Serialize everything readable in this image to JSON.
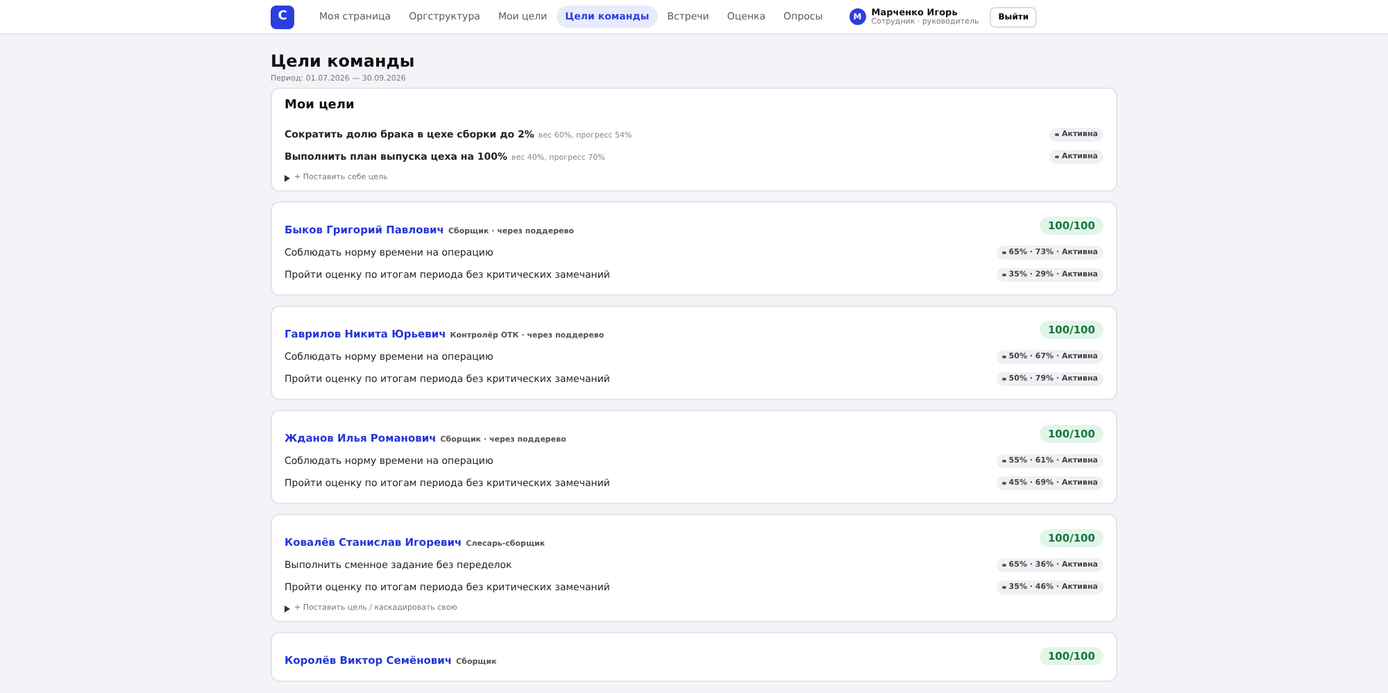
{
  "header": {
    "logo": "С",
    "nav": [
      {
        "label": "Моя страница",
        "selected": false
      },
      {
        "label": "Оргструктура",
        "selected": false
      },
      {
        "label": "Мои цели",
        "selected": false
      },
      {
        "label": "Цели команды",
        "selected": true
      },
      {
        "label": "Встречи",
        "selected": false
      },
      {
        "label": "Оценка",
        "selected": false
      },
      {
        "label": "Опросы",
        "selected": false
      }
    ],
    "user": {
      "initial": "М",
      "name": "Марченко Игорь",
      "role": "Сотрудник · руководитель"
    },
    "logout": "Выйти"
  },
  "page": {
    "title": "Цели команды",
    "period": "Период: 01.07.2026 — 30.09.2026"
  },
  "my_goals": {
    "title": "Мои цели",
    "goals": [
      {
        "title": "Сократить долю брака в цехе сборки до 2%",
        "meta": "вес 60%, прогресс 54%",
        "status": "Активна"
      },
      {
        "title": "Выполнить план выпуска цеха на 100%",
        "meta": "вес 40%, прогресс 70%",
        "status": "Активна"
      }
    ],
    "add": "+ Поставить себе цель"
  },
  "team": [
    {
      "name": "Быков Григорий Павлович",
      "role": "Сборщик · через поддерево",
      "score": "100/100",
      "goals": [
        {
          "title": "Соблюдать норму времени на операцию",
          "status": "65% · 73% · Активна"
        },
        {
          "title": "Пройти оценку по итогам периода без критических замечаний",
          "status": "35% · 29% · Активна"
        }
      ]
    },
    {
      "name": "Гаврилов Никита Юрьевич",
      "role": "Контролёр ОТК · через поддерево",
      "score": "100/100",
      "goals": [
        {
          "title": "Соблюдать норму времени на операцию",
          "status": "50% · 67% · Активна"
        },
        {
          "title": "Пройти оценку по итогам периода без критических замечаний",
          "status": "50% · 79% · Активна"
        }
      ]
    },
    {
      "name": "Жданов Илья Романович",
      "role": "Сборщик · через поддерево",
      "score": "100/100",
      "goals": [
        {
          "title": "Соблюдать норму времени на операцию",
          "status": "55% · 61% · Активна"
        },
        {
          "title": "Пройти оценку по итогам периода без критических замечаний",
          "status": "45% · 69% · Активна"
        }
      ]
    },
    {
      "name": "Ковалёв Станислав Игоревич",
      "role": "Слесарь-сборщик",
      "score": "100/100",
      "goals": [
        {
          "title": "Выполнить сменное задание без переделок",
          "status": "65% · 36% · Активна"
        },
        {
          "title": "Пройти оценку по итогам периода без критических замечаний",
          "status": "35% · 46% · Активна"
        }
      ],
      "add": "+ Поставить цель / каскадировать свою"
    },
    {
      "name": "Королёв Виктор Семёнович",
      "role": "Сборщик",
      "score": "100/100"
    }
  ]
}
